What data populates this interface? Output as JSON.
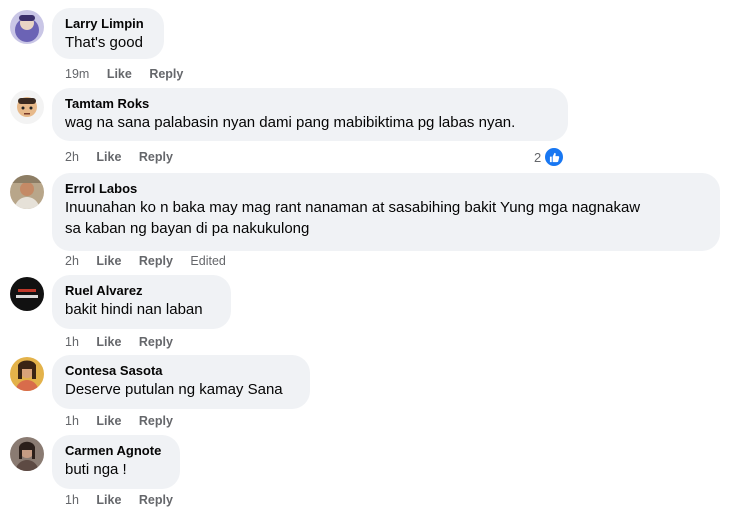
{
  "comments": [
    {
      "name": "Larry Limpin",
      "text": "That's good",
      "time": "19m",
      "like": "Like",
      "reply": "Reply",
      "avatar_icon": "cartoon-avatar-icon"
    },
    {
      "name": "Tamtam Roks",
      "text": "wag na sana palabasin nyan dami pang mabibiktima pg labas nyan.",
      "time": "2h",
      "like": "Like",
      "reply": "Reply",
      "reaction_count": "2",
      "avatar_icon": "cartoon-avatar-icon"
    },
    {
      "name": "Errol Labos",
      "text": "Inuunahan ko n baka may mag rant nanaman at sasabihing bakit Yung mga nagnakaw\nsa kaban ng bayan di pa nakukulong",
      "time": "2h",
      "like": "Like",
      "reply": "Reply",
      "edited": "Edited",
      "avatar_icon": "profile-photo-icon"
    },
    {
      "name": "Ruel Alvarez",
      "text": "bakit hindi nan laban",
      "time": "1h",
      "like": "Like",
      "reply": "Reply",
      "avatar_icon": "profile-photo-icon"
    },
    {
      "name": "Contesa Sasota",
      "text": "Deserve putulan ng kamay Sana",
      "time": "1h",
      "like": "Like",
      "reply": "Reply",
      "avatar_icon": "profile-photo-icon"
    },
    {
      "name": "Carmen Agnote",
      "text": "buti nga !",
      "time": "1h",
      "like": "Like",
      "reply": "Reply",
      "avatar_icon": "profile-photo-icon"
    }
  ],
  "colors": {
    "bubble": "#f0f2f5",
    "meta": "#65676b",
    "like_badge": "#1877f2"
  }
}
